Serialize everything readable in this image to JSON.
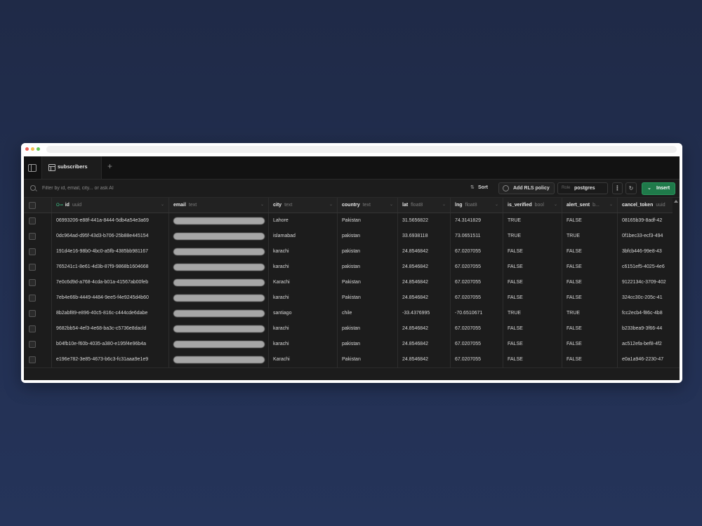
{
  "tab": {
    "label": "subscribers",
    "add": "+"
  },
  "toolbar": {
    "filter_placeholder": "Filter by id, email, city... or ask AI",
    "sort_label": "Sort",
    "rls_label": "Add RLS policy",
    "role_label": "Role",
    "role_value": "postgres",
    "more_label": "⋮",
    "refresh_label": "↻",
    "insert_label": "Insert",
    "insert_chevron": "⌄"
  },
  "columns": [
    {
      "name": "id",
      "type": "uuid",
      "key": "O⊸"
    },
    {
      "name": "email",
      "type": "text"
    },
    {
      "name": "city",
      "type": "text"
    },
    {
      "name": "country",
      "type": "text"
    },
    {
      "name": "lat",
      "type": "float8"
    },
    {
      "name": "lng",
      "type": "float8"
    },
    {
      "name": "is_verified",
      "type": "bool"
    },
    {
      "name": "alert_sent",
      "type": "b..."
    },
    {
      "name": "cancel_token",
      "type": "uuid"
    }
  ],
  "rows": [
    {
      "id": "06993206-e88f-441a-8444-5db4a54e3a69",
      "city": "Lahore",
      "country": "Pakistan",
      "lat": "31.5656822",
      "lng": "74.3141829",
      "is_verified": "TRUE",
      "alert_sent": "FALSE",
      "cancel_token": "08165b39-8adf-42"
    },
    {
      "id": "0dc964ad-d95f-43d3-b706-25b88e445154",
      "city": "islamabad",
      "country": "pakistan",
      "lat": "33.6938118",
      "lng": "73.0651511",
      "is_verified": "TRUE",
      "alert_sent": "TRUE",
      "cancel_token": "0f1bec33-ecf3-494"
    },
    {
      "id": "191d4e16-98b0-4bc0-a5fb-4385bb981167",
      "city": "karachi",
      "country": "pakistan",
      "lat": "24.8546842",
      "lng": "67.0207055",
      "is_verified": "FALSE",
      "alert_sent": "FALSE",
      "cancel_token": "3bfcb446-99e8-43"
    },
    {
      "id": "765241c1-8e61-4d3b-87f9-9868b1604668",
      "city": "karachi",
      "country": "pakistan",
      "lat": "24.8546842",
      "lng": "67.0207055",
      "is_verified": "FALSE",
      "alert_sent": "FALSE",
      "cancel_token": "c6151ef5-4025-4e6"
    },
    {
      "id": "7e0c6d9d-a768-4cda-b01a-41567ab00feb",
      "city": "Karachi",
      "country": "Pakistan",
      "lat": "24.8546842",
      "lng": "67.0207055",
      "is_verified": "FALSE",
      "alert_sent": "FALSE",
      "cancel_token": "9122134c-3709-402"
    },
    {
      "id": "7eb4e66b-4449-4484-9ee5-f4e9245d4b60",
      "city": "karachi",
      "country": "Pakistan",
      "lat": "24.8546842",
      "lng": "67.0207055",
      "is_verified": "FALSE",
      "alert_sent": "FALSE",
      "cancel_token": "324cc30c-205c-41"
    },
    {
      "id": "8b2abf89-e896-40c5-816c-c444cde6dabe",
      "city": "santiago",
      "country": "chile",
      "lat": "-33.4376995",
      "lng": "-70.6510671",
      "is_verified": "TRUE",
      "alert_sent": "TRUE",
      "cancel_token": "fcc2ecb4-f86c-4b8"
    },
    {
      "id": "9682bb54-4ef3-4e68-ba3c-c5736e8dacld",
      "city": "karachi",
      "country": "pakistan",
      "lat": "24.8546842",
      "lng": "67.0207055",
      "is_verified": "FALSE",
      "alert_sent": "FALSE",
      "cancel_token": "b233bea9-3f66-44"
    },
    {
      "id": "b04fb10e-f60b-4035-a380-e195f4e96b4a",
      "city": "karachi",
      "country": "pakistan",
      "lat": "24.8546842",
      "lng": "67.0207055",
      "is_verified": "FALSE",
      "alert_sent": "FALSE",
      "cancel_token": "ac512efa-bef8-4f2"
    },
    {
      "id": "e196e782-3e85-4673-b6c3-fc31aaa9e1e9",
      "city": "Karachi",
      "country": "Pakistan",
      "lat": "24.8546842",
      "lng": "67.0207055",
      "is_verified": "FALSE",
      "alert_sent": "FALSE",
      "cancel_token": "e0a1a946-2230-47"
    }
  ],
  "colors": {
    "accent": "#1f7a4a",
    "key_icon": "#3ecf8e",
    "background": "#1f2a47"
  }
}
